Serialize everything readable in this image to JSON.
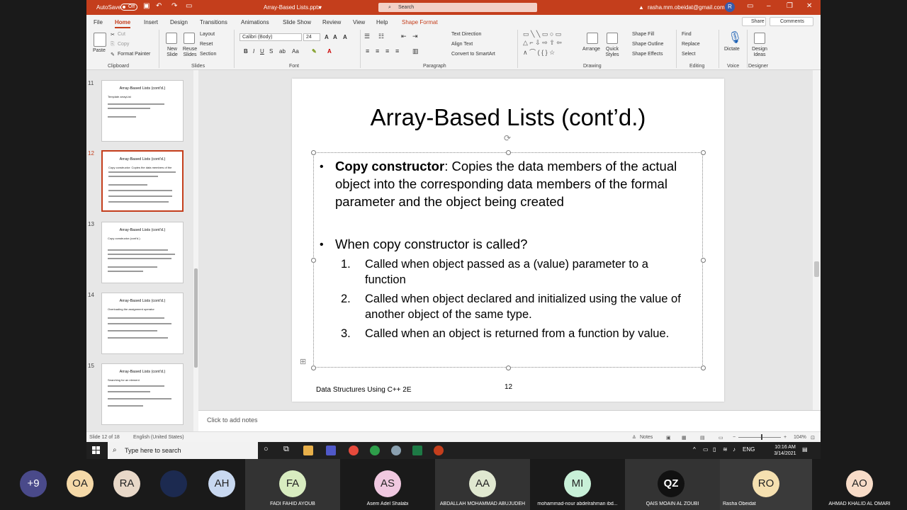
{
  "titlebar": {
    "autosave_label": "AutoSave",
    "autosave_state": "Off",
    "filename": "Array-Based Lists.pptx",
    "search_placeholder": "Search",
    "account_email": "rasha.mm.obeidat@gmail.com",
    "avatar_initial": "R"
  },
  "tabs": [
    "File",
    "Home",
    "Insert",
    "Design",
    "Transitions",
    "Animations",
    "Slide Show",
    "Review",
    "View",
    "Help",
    "Shape Format"
  ],
  "share_label": "Share",
  "comments_label": "Comments",
  "ribbon": {
    "paste": "Paste",
    "cut": "Cut",
    "copy": "Copy",
    "format_painter": "Format Painter",
    "clipboard": "Clipboard",
    "new_slide": "New Slide",
    "reuse_slides": "Reuse Slides",
    "layout": "Layout",
    "reset": "Reset",
    "section": "Section",
    "slides": "Slides",
    "font_name": "Calibri (Body)",
    "font_size": "24",
    "font": "Font",
    "text_direction": "Text Direction",
    "align_text": "Align Text",
    "convert_smartart": "Convert to SmartArt",
    "paragraph": "Paragraph",
    "arrange": "Arrange",
    "quick_styles": "Quick Styles",
    "shape_fill": "Shape Fill",
    "shape_outline": "Shape Outline",
    "shape_effects": "Shape Effects",
    "drawing": "Drawing",
    "find": "Find",
    "replace": "Replace",
    "select": "Select",
    "editing": "Editing",
    "dictate": "Dictate",
    "voice": "Voice",
    "design_ideas": "Design Ideas",
    "designer": "Designer"
  },
  "thumbnails": [
    {
      "num": "11",
      "title": "Array-Based Lists (cont'd.)",
      "sub": "Template arrayList"
    },
    {
      "num": "12",
      "title": "Array-Based Lists (cont'd.)",
      "sub": "Copy constructor: Copies the data members of the",
      "selected": true
    },
    {
      "num": "13",
      "title": "Array-Based Lists (cont'd.)",
      "sub": "Copy constructor (cont'd.)"
    },
    {
      "num": "14",
      "title": "Array-Based Lists (cont'd.)",
      "sub": "Overloading the assignment operator"
    },
    {
      "num": "15",
      "title": "Array-Based Lists (cont'd.)",
      "sub": "Searching for an element"
    }
  ],
  "slide": {
    "title": "Array-Based Lists (cont’d.)",
    "b1_bold": "Copy constructor",
    "b1_text": ":  Copies the data members of the actual object into the corresponding data members of the formal parameter and the object being created",
    "b2_text": "When copy constructor is called?",
    "items": [
      {
        "n": "1.",
        "text": "Called when object passed as a (value) parameter to a function"
      },
      {
        "n": "2.",
        "text": "Called when object declared and initialized using the value of another object of the same type."
      },
      {
        "n": "3.",
        "text": "Called when an object is returned from a function by value."
      }
    ],
    "footer": "Data Structures Using C++ 2E",
    "number": "12"
  },
  "notes_placeholder": "Click to add notes",
  "status": {
    "slide_count": "Slide 12 of 18",
    "language": "English (United States)",
    "notes": "Notes",
    "zoom": "104%"
  },
  "taskbar": {
    "search_placeholder": "Type here to search",
    "lang": "ENG",
    "time": "10:16 AM",
    "date": "3/14/2021"
  },
  "participants": [
    {
      "initials": "+9",
      "name": "",
      "color": "#4a4a8a",
      "fg": "#fff"
    },
    {
      "initials": "OA",
      "name": "",
      "color": "#f5d9a8",
      "fg": "#222"
    },
    {
      "initials": "RA",
      "name": "",
      "color": "#e8d8c8",
      "fg": "#222"
    },
    {
      "initials": "",
      "name": "",
      "color": "#1c2a50",
      "fg": "#fff"
    },
    {
      "initials": "AH",
      "name": "",
      "color": "#c8d8f0",
      "fg": "#222"
    },
    {
      "initials": "FA",
      "name": "FADI FAHID AYOUB",
      "color": "#d8ecc0",
      "fg": "#222"
    },
    {
      "initials": "AS",
      "name": "Asem Adel Shalabi",
      "color": "#f0c8e0",
      "fg": "#222"
    },
    {
      "initials": "AA",
      "name": "ABDALLAH MOHAMMAD ABUJUDEH",
      "color": "#e0e8d0",
      "fg": "#222"
    },
    {
      "initials": "MI",
      "name": "mohammad-nour abdelrahman ibd...",
      "color": "#c8f0d8",
      "fg": "#222"
    },
    {
      "initials": "QZ",
      "name": "QAIS MOAIN AL ZOUBI",
      "color": "#111111",
      "fg": "#fff"
    },
    {
      "initials": "RO",
      "name": "Rasha Obeidat",
      "color": "#f5e0b0",
      "fg": "#222"
    },
    {
      "initials": "AO",
      "name": "AHMAD KHALID AL OMARI",
      "color": "#f8dcc8",
      "fg": "#222"
    }
  ]
}
